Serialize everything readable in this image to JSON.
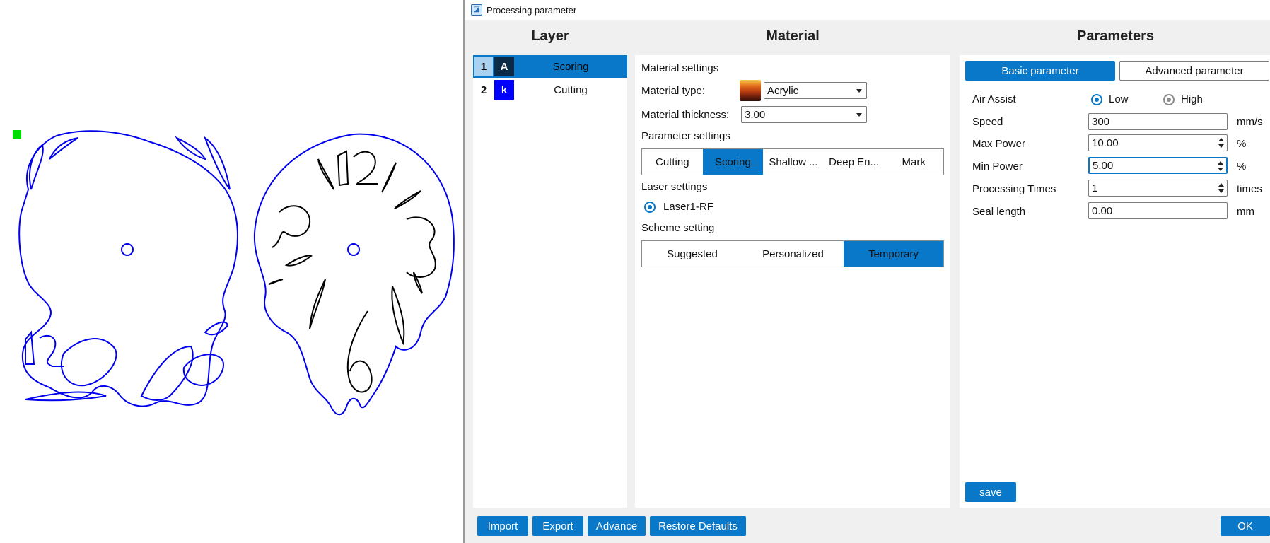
{
  "window": {
    "title": "Processing parameter"
  },
  "headers": {
    "layer": "Layer",
    "material": "Material",
    "parameters": "Parameters"
  },
  "layers": [
    {
      "number": "1",
      "code": "A",
      "name": "Scoring",
      "swatch_color": "#0b2a45",
      "selected": true
    },
    {
      "number": "2",
      "code": "k",
      "name": "Cutting",
      "swatch_color": "#0000ff",
      "selected": false
    }
  ],
  "material": {
    "settings_heading": "Material settings",
    "type_label": "Material type:",
    "type_value": "Acrylic",
    "thickness_label": "Material thickness:",
    "thickness_value": "3.00",
    "parameter_settings_heading": "Parameter settings",
    "parameter_tabs": [
      "Cutting",
      "Scoring",
      "Shallow ...",
      "Deep En...",
      "Mark"
    ],
    "parameter_active": "Scoring",
    "laser_heading": "Laser settings",
    "laser_option": "Laser1-RF",
    "scheme_heading": "Scheme setting",
    "scheme_tabs": [
      "Suggested",
      "Personalized",
      "Temporary"
    ],
    "scheme_active": "Temporary"
  },
  "parameters": {
    "tab_basic": "Basic parameter",
    "tab_advanced": "Advanced parameter",
    "air_assist_label": "Air Assist",
    "air_low": "Low",
    "air_high": "High",
    "speed_label": "Speed",
    "speed_value": "300",
    "speed_unit": "mm/s",
    "max_power_label": "Max Power",
    "max_power_value": "10.00",
    "max_power_unit": "%",
    "min_power_label": "Min Power",
    "min_power_value": "5.00",
    "min_power_unit": "%",
    "times_label": "Processing Times",
    "times_value": "1",
    "times_unit": "times",
    "seal_label": "Seal length",
    "seal_value": "0.00",
    "seal_unit": "mm",
    "save_label": "save"
  },
  "footer": {
    "import_label": "Import",
    "export_label": "Export",
    "advance_label": "Advance",
    "restore_label": "Restore Defaults",
    "ok_label": "OK"
  },
  "colors": {
    "accent": "#0a78c8",
    "design_stroke": "#0000ee",
    "design_stroke_dark": "#000000",
    "marker": "#00dd00"
  }
}
